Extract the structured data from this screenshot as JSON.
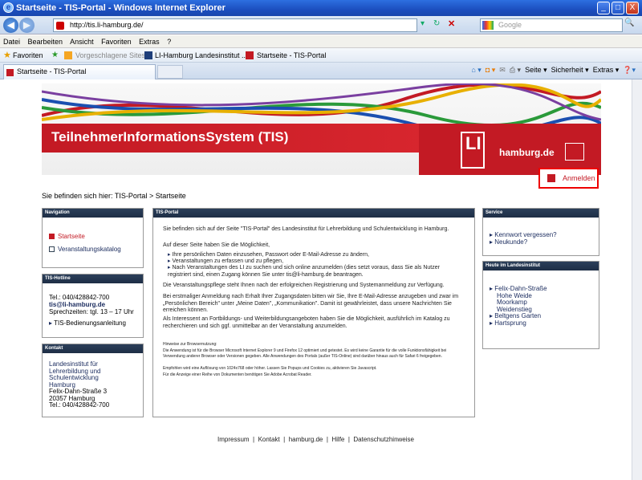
{
  "window": {
    "title": "Startseite - TIS-Portal - Windows Internet Explorer",
    "minimize": "_",
    "maximize": "□",
    "close": "X"
  },
  "address": {
    "url": "http://tis.li-hamburg.de/",
    "search_placeholder": "Google"
  },
  "menu": [
    "Datei",
    "Bearbeiten",
    "Ansicht",
    "Favoriten",
    "Extras",
    "?"
  ],
  "favorites": {
    "label": "Favoriten",
    "items": [
      "Vorgeschlagene Sites ▾",
      "LI-Hamburg Landesinstitut ...",
      "Startseite - TIS-Portal"
    ]
  },
  "tab": {
    "label": "Startseite - TIS-Portal"
  },
  "command_bar": [
    "Seite ▾",
    "Sicherheit ▾",
    "Extras ▾"
  ],
  "banner": {
    "title": "TeilnehmerInformationsSystem (TIS)",
    "hamburg": "hamburg.de",
    "li": "LI"
  },
  "login": {
    "label": "Anmelden"
  },
  "breadcrumb": {
    "prefix": "Sie befinden sich hier:",
    "item1": "TIS-Portal",
    "sep": ">",
    "item2": "Startseite"
  },
  "navigation": {
    "title": "Navigation",
    "items": [
      "Startseite",
      "Veranstaltungskatalog"
    ]
  },
  "hotline": {
    "title": "TIS-Hotline",
    "tel": "Tel.: 040/428842-700",
    "email": "tis@li-hamburg.de",
    "hours": "Sprechzeiten: tgl. 13 – 17 Uhr",
    "manual": "TIS-Bedienungsanleitung"
  },
  "contact": {
    "title": "Kontakt",
    "org1": "Landesinstitut für",
    "org2": "Lehrerbildung und",
    "org3": "Schulentwicklung",
    "city": "Hamburg",
    "street": "Felix-Dahn-Straße 3",
    "zip": "20357 Hamburg",
    "tel": "Tel.: 040/428842-700"
  },
  "portal": {
    "title": "TIS-Portal",
    "p1": "Sie befinden sich auf der Seite \"TIS-Portal\" des Landesinstitut für Lehrerbildung und Schulentwicklung in Hamburg.",
    "p2": "Auf dieser Seite haben Sie die Möglichkeit,",
    "b1": "Ihre persönlichen Daten einzusehen, Passwort oder E-Mail-Adresse zu ändern,",
    "b2": "Veranstaltungen zu erfassen und zu pflegen,",
    "b3": "Nach Veranstaltungen des LI zu suchen und sich online anzumelden (dies setzt voraus, dass Sie als Nutzer registriert sind, einen Zugang können Sie unter tis@li-hamburg.de beantragen.",
    "p3": "Die Veranstaltungspflege steht Ihnen nach der erfolgreichen Registrierung und Systemanmeldung zur Verfügung.",
    "p4": "Bei erstmaliger Anmeldung nach Erhalt Ihrer Zugangsdaten bitten wir Sie, Ihre E-Mail-Adresse anzugeben und zwar im „Persönlichen Bereich\" unter „Meine Daten\", „Kommunikation\". Damit ist gewährleistet, dass unsere Nachrichten Sie erreichen können.",
    "p5": "Als Interessent an Fortbildungs- und Weiterbildungsangeboten haben Sie die Möglichkeit, ausführlich im Katalog zu recherchieren und sich ggf. unmittelbar an der Veranstaltung anzumelden.",
    "h1": "Hinweise zur Browsernutzung:",
    "h2": "Die Anwendung ist für die Browser Microsoft Internet Explorer 9 und Firefox 12 optimiert und getestet. Es wird keine Garantie für die volle Funktionsfähigkeit bei Verwendung anderer Browser oder Versionen gegeben. Alle Anwendungen des Portals (außer TIS-Online) sind darüber hinaus auch für Safari 6 freigegeben.",
    "h3": "Empfohlen wird eine Auflösung von 1024x768 oder höher. Lassen Sie Popups und Cookies zu, aktivieren Sie Javascript.",
    "h4": "Für die Anzeige einer Reihe von Dokumenten benötigen Sie Adobe Acrobat Reader."
  },
  "service": {
    "title": "Service",
    "items": [
      "Kennwort vergessen?",
      "Neukunde?"
    ]
  },
  "today": {
    "title": "Heute im Landesinstitut",
    "items": [
      "Felix-Dahn-Straße",
      "Hohe Weide",
      "Moorkamp",
      "Weidenstieg",
      "Beltgens Garten",
      "Hartsprung"
    ]
  },
  "footer": {
    "links": [
      "Impressum",
      "Kontakt",
      "hamburg.de",
      "Hilfe",
      "Datenschutzhinweise"
    ],
    "sep": "|"
  }
}
